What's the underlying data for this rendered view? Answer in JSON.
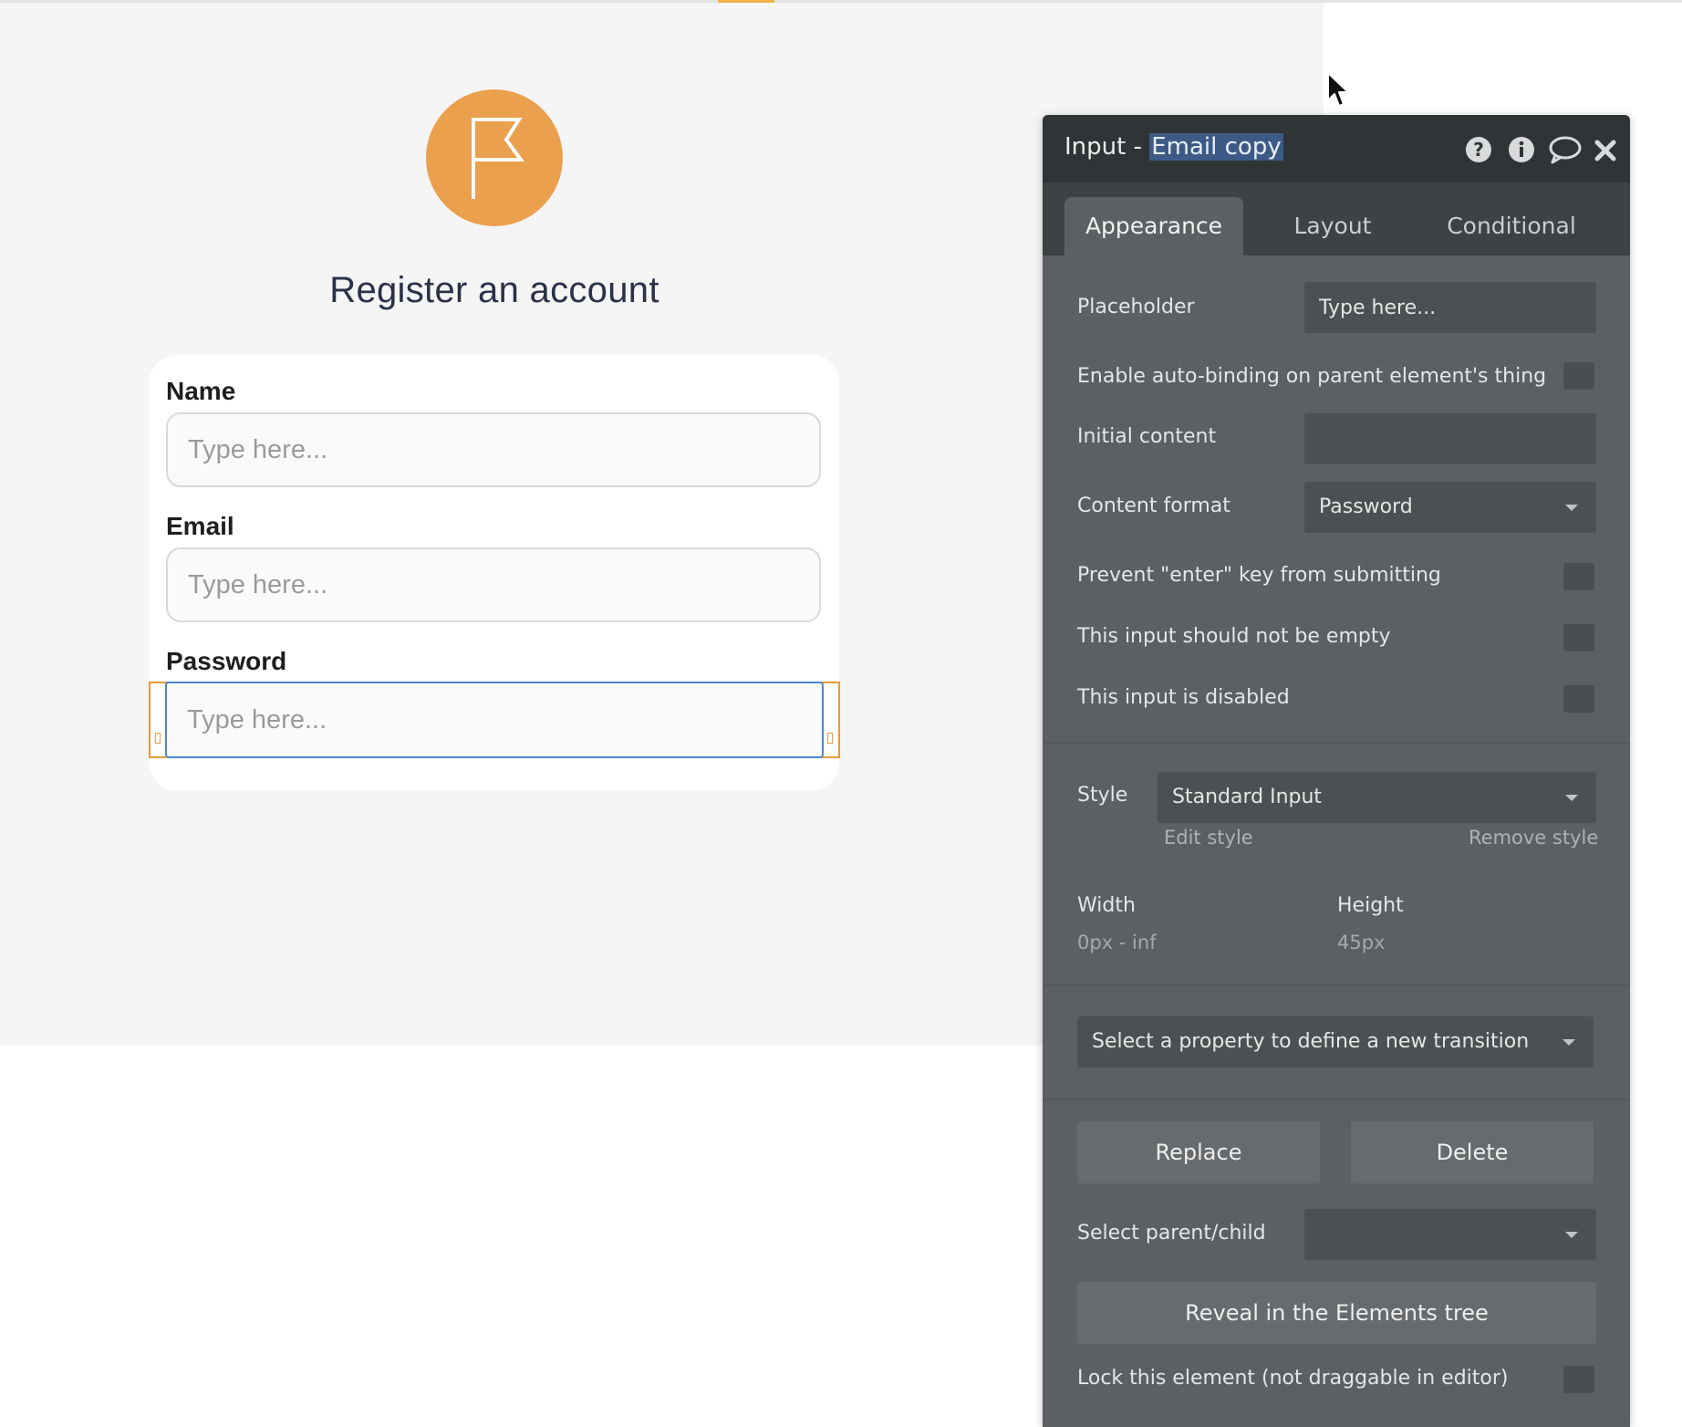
{
  "canvas": {
    "page_title": "Register an account",
    "logo_icon": "flag-icon",
    "form": {
      "name_label": "Name",
      "name_placeholder": "Type here...",
      "email_label": "Email",
      "email_placeholder": "Type here...",
      "password_label": "Password",
      "password_placeholder": "Type here..."
    }
  },
  "panel": {
    "title_prefix": "Input - ",
    "title_name": "Email copy",
    "header_icons": [
      "help-icon",
      "info-icon",
      "comment-icon",
      "close-icon"
    ],
    "tabs": [
      {
        "label": "Appearance",
        "active": true
      },
      {
        "label": "Layout",
        "active": false
      },
      {
        "label": "Conditional",
        "active": false
      }
    ],
    "placeholder_label": "Placeholder",
    "placeholder_value": "Type here...",
    "autobinding_label": "Enable auto-binding on parent element's thing",
    "initial_content_label": "Initial content",
    "initial_content_value": "",
    "content_format_label": "Content format",
    "content_format_value": "Password",
    "prevent_enter_label": "Prevent \"enter\" key from submitting",
    "not_empty_label": "This input should not be empty",
    "disabled_label": "This input is disabled",
    "style_label": "Style",
    "style_value": "Standard Input",
    "edit_style": "Edit style",
    "remove_style": "Remove style",
    "width_label": "Width",
    "width_value": "0px - inf",
    "height_label": "Height",
    "height_value": "45px",
    "transition_placeholder": "Select a property to define a new transition",
    "replace_button": "Replace",
    "delete_button": "Delete",
    "parent_child_label": "Select parent/child",
    "parent_child_value": "",
    "reveal_button": "Reveal in the Elements tree",
    "lock_label": "Lock this element (not draggable in editor)"
  },
  "colors": {
    "logo": "#eba04e",
    "panel_bg": "#5c6063",
    "panel_header": "#2f3436",
    "selection_outline": "#e89a3c",
    "focus_border": "#4a86d6"
  }
}
